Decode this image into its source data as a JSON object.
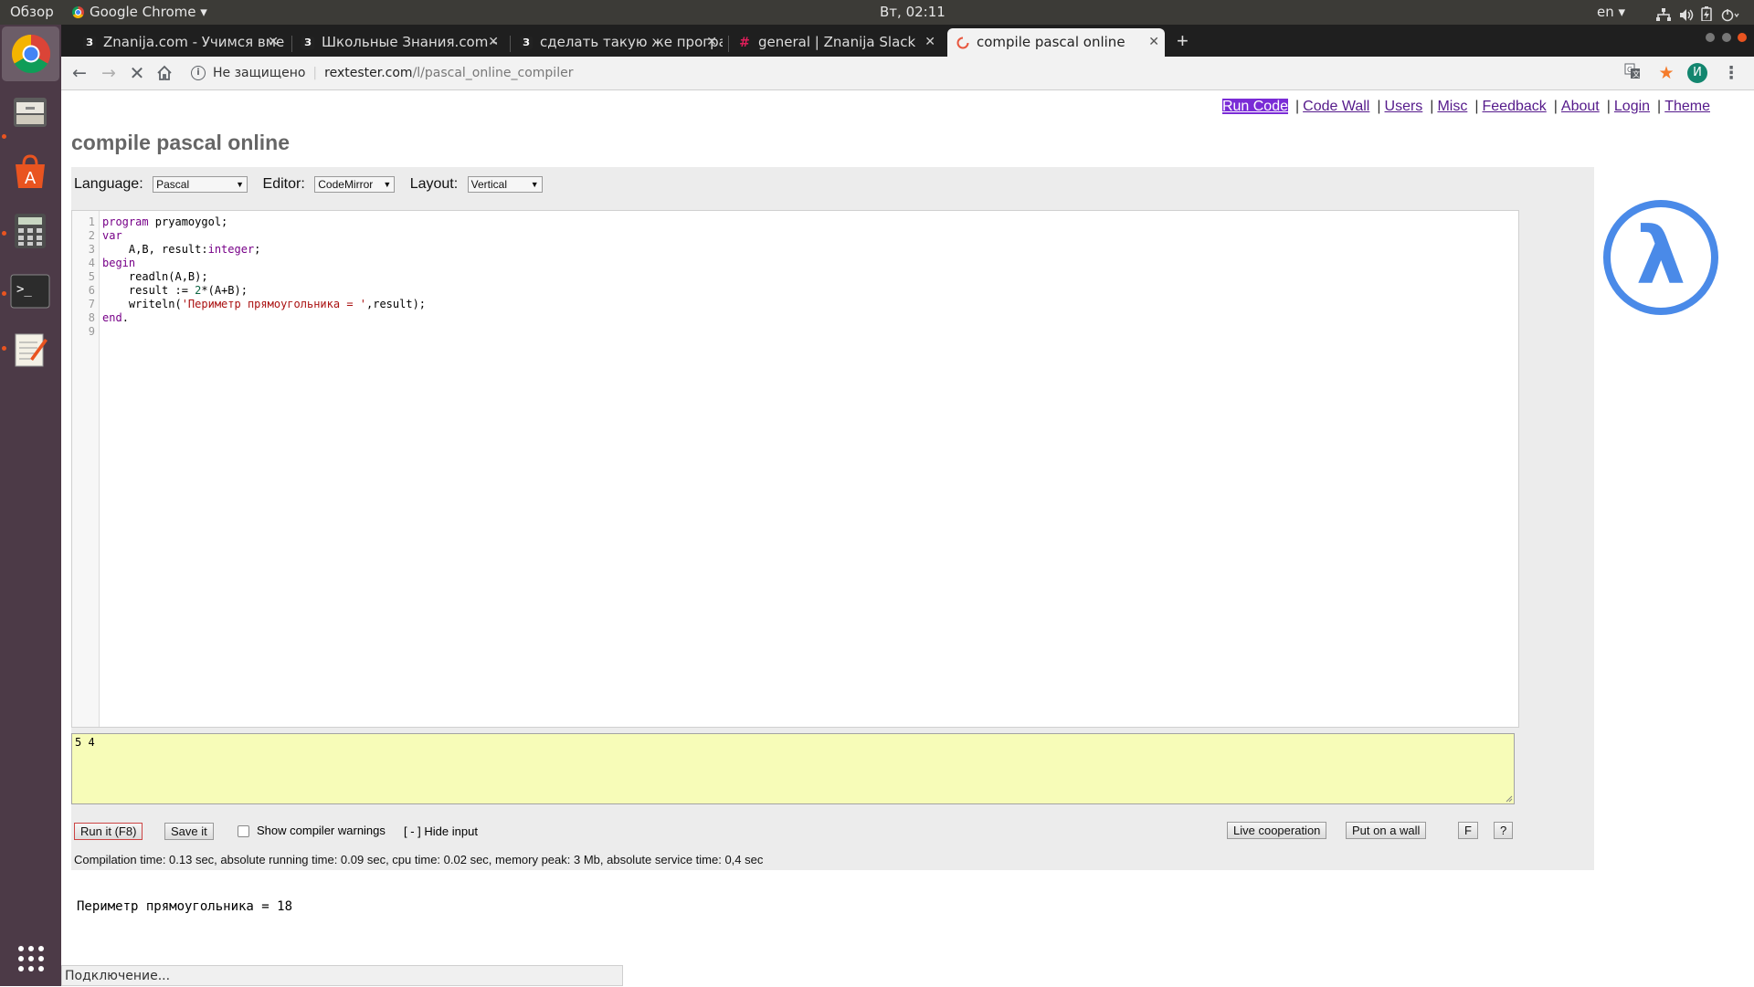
{
  "topbar": {
    "activities": "Обзор",
    "app": "Google Chrome",
    "app_arrow": "▾",
    "clock": "Вт, 02:11",
    "lang": "en",
    "lang_arrow": "▾",
    "tray_icons": [
      "network-icon",
      "volume-icon",
      "battery-icon",
      "power-icon"
    ]
  },
  "launcher": {
    "items": [
      "chrome-icon",
      "files-icon",
      "software-center-icon",
      "calculator-icon",
      "terminal-icon",
      "text-editor-icon",
      "apps-grid-icon"
    ]
  },
  "tabs": [
    {
      "favicon": "З",
      "title": "Znanija.com - Учимся вме",
      "active": false
    },
    {
      "favicon": "З",
      "title": "Школьные Знания.com -",
      "active": false
    },
    {
      "favicon": "З",
      "title": "сделать такую же програ",
      "active": false
    },
    {
      "favicon": "#",
      "title": "general | Znanija Slack",
      "active": false
    },
    {
      "favicon": "loading",
      "title": "compile pascal online",
      "active": true
    }
  ],
  "toolbar": {
    "security": "Не защищено",
    "url_host": "rextester.com",
    "url_path": "/l/pascal_online_compiler",
    "profile_initial": "И"
  },
  "nav": {
    "links": [
      "Run Code",
      "Code Wall",
      "Users",
      "Misc",
      "Feedback",
      "About",
      "Login",
      "Theme"
    ]
  },
  "page": {
    "title": "compile pascal online"
  },
  "options": {
    "language_label": "Language:",
    "language_value": "Pascal",
    "editor_label": "Editor:",
    "editor_value": "CodeMirror",
    "layout_label": "Layout:",
    "layout_value": "Vertical"
  },
  "code": {
    "line_numbers": [
      "1",
      "2",
      "3",
      "4",
      "5",
      "6",
      "7",
      "8",
      "9"
    ],
    "lines": [
      "program pryamoygol;",
      "var",
      "    A,B, result:integer;",
      "begin",
      "    readln(A,B);",
      "    result := 2*(A+B);",
      "    writeln('Периметр прямоугольника = ',result);",
      "end.",
      ""
    ]
  },
  "stdin": {
    "value": "5 4"
  },
  "actions": {
    "run": "Run it (F8)",
    "save": "Save it",
    "warnings": "Show compiler warnings",
    "hide_input": "[ - ] Hide input",
    "live": "Live cooperation",
    "wall": "Put on a wall",
    "f": "F",
    "help": "?"
  },
  "stats": "Compilation time: 0.13 sec, absolute running time: 0.09 sec, cpu time: 0.02 sec, memory peak: 3 Mb, absolute service time: 0,4 sec",
  "output": "Периметр прямоугольника = 18",
  "logo": "λ",
  "status": "Подключение..."
}
